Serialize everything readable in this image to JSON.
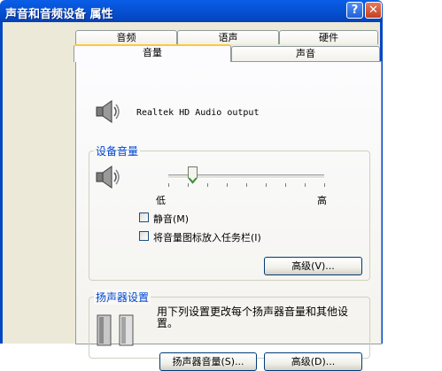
{
  "window": {
    "title": "声音和音频设备 属性",
    "help_glyph": "?",
    "close_glyph": "✕"
  },
  "tabs_row1": [
    "音频",
    "语声",
    "硬件"
  ],
  "tabs_row2": [
    "音量",
    "声音"
  ],
  "active_tab": "音量",
  "device": {
    "name": "Realtek HD Audio output"
  },
  "device_volume": {
    "group_title": "设备音量",
    "low_label": "低",
    "high_label": "高",
    "level_percent": 18,
    "mute_label": "静音(M)",
    "mute_checked": false,
    "tray_icon_label": "将音量图标放入任务栏(I)",
    "tray_icon_checked": false,
    "advanced_button": "高级(V)..."
  },
  "speaker_settings": {
    "group_title": "扬声器设置",
    "description_line1": "用下列设置更改每个扬声器音量和其他设",
    "description_line2": "置。",
    "speaker_volume_button": "扬声器音量(S)...",
    "advanced_button": "高级(D)..."
  },
  "colors": {
    "titlebar": "#0654d6",
    "dialog_bg": "#ece9d8",
    "group_title": "#0046d5",
    "active_tab_highlight": "#ffc83c"
  }
}
